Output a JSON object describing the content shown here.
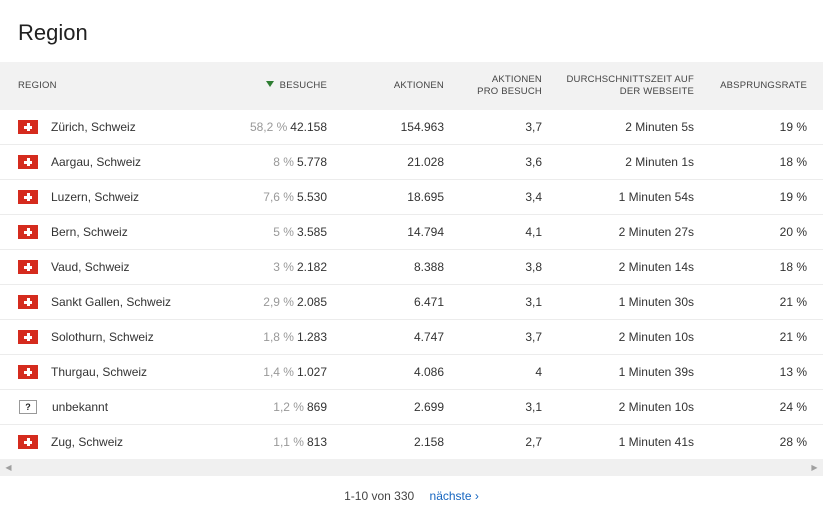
{
  "widget": {
    "title": "Region"
  },
  "columns": {
    "region": "Region",
    "visits": "Besuche",
    "actions": "Aktionen",
    "actions_per_visit_line1": "Aktionen",
    "actions_per_visit_line2": "pro Besuch",
    "avg_time_line1": "Durchschnittszeit auf",
    "avg_time_line2": "der Webseite",
    "bounce_rate": "Absprungsrate"
  },
  "sort": {
    "column": "visits",
    "direction": "descending",
    "icon": "sort-desc-icon",
    "color": "#2e7d32"
  },
  "rows": [
    {
      "flag": "ch",
      "region": "Zürich, Schweiz",
      "visits_pct": "58,2 %",
      "visits": "42.158",
      "actions": "154.963",
      "actions_per_visit": "3,7",
      "avg_time": "2 Minuten 5s",
      "bounce_rate": "19 %"
    },
    {
      "flag": "ch",
      "region": "Aargau, Schweiz",
      "visits_pct": "8 %",
      "visits": "5.778",
      "actions": "21.028",
      "actions_per_visit": "3,6",
      "avg_time": "2 Minuten 1s",
      "bounce_rate": "18 %"
    },
    {
      "flag": "ch",
      "region": "Luzern, Schweiz",
      "visits_pct": "7,6 %",
      "visits": "5.530",
      "actions": "18.695",
      "actions_per_visit": "3,4",
      "avg_time": "1 Minuten 54s",
      "bounce_rate": "19 %"
    },
    {
      "flag": "ch",
      "region": "Bern, Schweiz",
      "visits_pct": "5 %",
      "visits": "3.585",
      "actions": "14.794",
      "actions_per_visit": "4,1",
      "avg_time": "2 Minuten 27s",
      "bounce_rate": "20 %"
    },
    {
      "flag": "ch",
      "region": "Vaud, Schweiz",
      "visits_pct": "3 %",
      "visits": "2.182",
      "actions": "8.388",
      "actions_per_visit": "3,8",
      "avg_time": "2 Minuten 14s",
      "bounce_rate": "18 %"
    },
    {
      "flag": "ch",
      "region": "Sankt Gallen, Schweiz",
      "visits_pct": "2,9 %",
      "visits": "2.085",
      "actions": "6.471",
      "actions_per_visit": "3,1",
      "avg_time": "1 Minuten 30s",
      "bounce_rate": "21 %"
    },
    {
      "flag": "ch",
      "region": "Solothurn, Schweiz",
      "visits_pct": "1,8 %",
      "visits": "1.283",
      "actions": "4.747",
      "actions_per_visit": "3,7",
      "avg_time": "2 Minuten 10s",
      "bounce_rate": "21 %"
    },
    {
      "flag": "ch",
      "region": "Thurgau, Schweiz",
      "visits_pct": "1,4 %",
      "visits": "1.027",
      "actions": "4.086",
      "actions_per_visit": "4",
      "avg_time": "1 Minuten 39s",
      "bounce_rate": "13 %"
    },
    {
      "flag": "unknown",
      "flag_symbol": "?",
      "region": "unbekannt",
      "visits_pct": "1,2 %",
      "visits": "869",
      "actions": "2.699",
      "actions_per_visit": "3,1",
      "avg_time": "2 Minuten 10s",
      "bounce_rate": "24 %"
    },
    {
      "flag": "ch",
      "region": "Zug, Schweiz",
      "visits_pct": "1,1 %",
      "visits": "813",
      "actions": "2.158",
      "actions_per_visit": "2,7",
      "avg_time": "1 Minuten 41s",
      "bounce_rate": "28 %"
    }
  ],
  "scrollbar": {
    "left_arrow": "◀",
    "right_arrow": "▶"
  },
  "pagination": {
    "range": "1-10 von 330",
    "next_label": "nächste ›"
  },
  "colors": {
    "header_bg": "#f2f2f2",
    "link": "#1565c0",
    "swiss_red": "#d52b1e"
  }
}
